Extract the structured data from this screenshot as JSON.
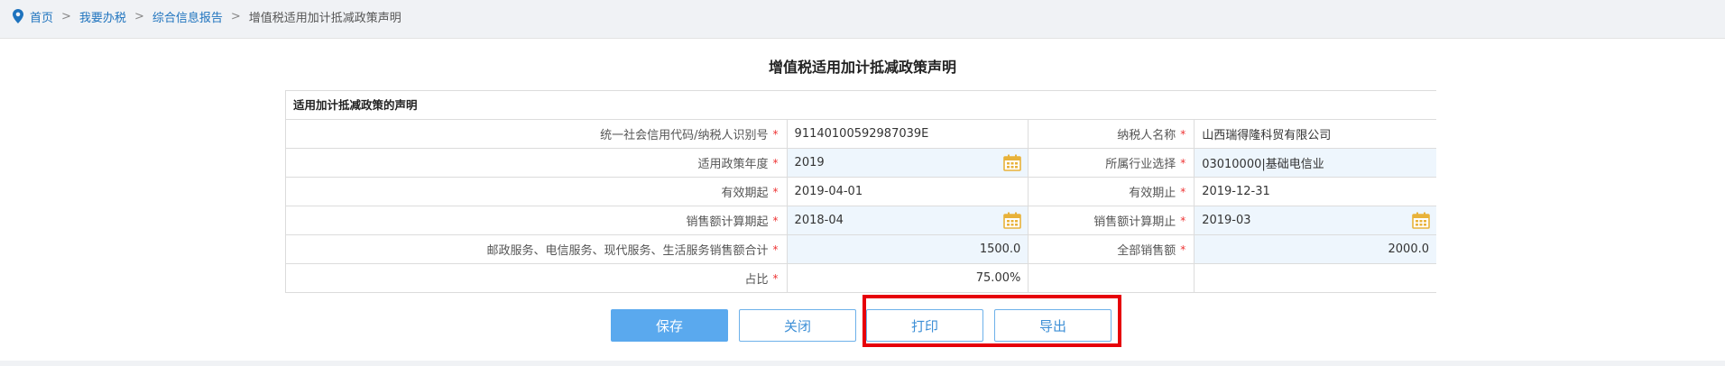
{
  "breadcrumb": {
    "home": "首页",
    "level2": "我要办税",
    "level3": "综合信息报告",
    "current": "增值税适用加计抵减政策声明",
    "separator": ">"
  },
  "page": {
    "title": "增值税适用加计抵减政策声明"
  },
  "form": {
    "section_title": "适用加计抵减政策的声明",
    "required_mark": "*",
    "rows": [
      {
        "label1": "统一社会信用代码/纳税人识别号",
        "value1": "91140100592987039E",
        "label2": "纳税人名称",
        "value2": "山西瑞得隆科贸有限公司"
      },
      {
        "label1": "适用政策年度",
        "value1": "2019",
        "label2": "所属行业选择",
        "value2": "03010000|基础电信业"
      },
      {
        "label1": "有效期起",
        "value1": "2019-04-01",
        "label2": "有效期止",
        "value2": "2019-12-31"
      },
      {
        "label1": "销售额计算期起",
        "value1": "2018-04",
        "label2": "销售额计算期止",
        "value2": "2019-03"
      },
      {
        "label1": "邮政服务、电信服务、现代服务、生活服务销售额合计",
        "value1": "1500.0",
        "label2": "全部销售额",
        "value2": "2000.0"
      },
      {
        "label1": "占比",
        "value1": "75.00%",
        "label2": "",
        "value2": ""
      }
    ]
  },
  "buttons": {
    "save": "保存",
    "close": "关闭",
    "print": "打印",
    "export": "导出"
  },
  "colors": {
    "link": "#1e73be",
    "primary": "#5aa9ee",
    "input_bg": "#eef6fd",
    "required": "#e33333",
    "highlight": "#e6000a",
    "calendar": "#e8b23a"
  },
  "icons": {
    "breadcrumb": "location-pin-icon",
    "date_picker": "calendar-icon"
  }
}
